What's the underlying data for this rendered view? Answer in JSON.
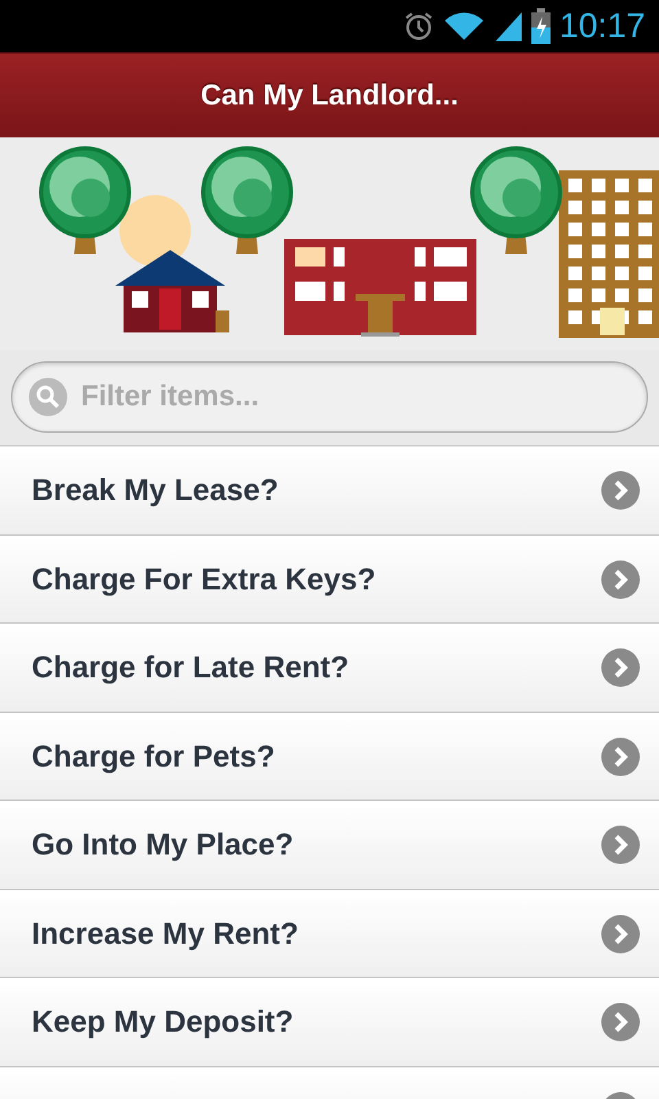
{
  "status_bar": {
    "time": "10:17"
  },
  "header": {
    "title": "Can My Landlord..."
  },
  "search": {
    "placeholder": "Filter items..."
  },
  "items": [
    {
      "label": "Break My Lease?"
    },
    {
      "label": "Charge For Extra Keys?"
    },
    {
      "label": "Charge for Late Rent?"
    },
    {
      "label": "Charge for Pets?"
    },
    {
      "label": "Go Into My Place?"
    },
    {
      "label": "Increase My Rent?"
    },
    {
      "label": "Keep My Deposit?"
    }
  ],
  "partial_row_below": true
}
